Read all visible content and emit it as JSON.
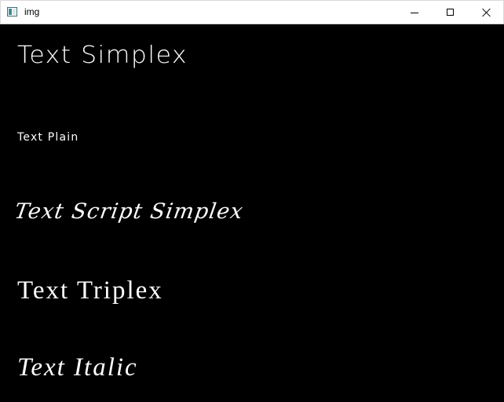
{
  "window": {
    "title": "img",
    "icon": "app-window-icon",
    "controls": [
      "minimize-icon",
      "maximize-icon",
      "close-icon"
    ]
  },
  "colors": {
    "titlebar_background": "#ffffff",
    "canvas_background": "#000000",
    "text": "#ffffff"
  },
  "samples": {
    "simplex": "Text Simplex",
    "plain": "Text Plain",
    "script_simplex": "Text Script Simplex",
    "triplex": "Text Triplex",
    "italic": "Text Italic"
  }
}
